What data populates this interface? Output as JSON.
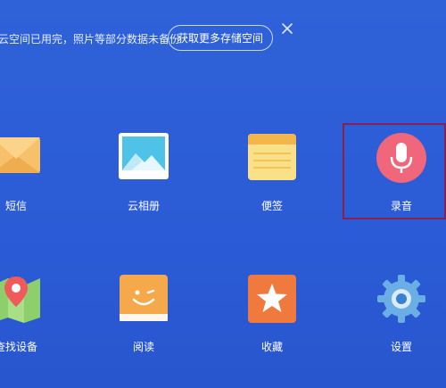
{
  "banner": {
    "text": "云空间已用完，照片等部分数据未备份",
    "button_label": "获取更多存储空间",
    "close_icon": "close-icon"
  },
  "apps": {
    "sms": {
      "label": "短信",
      "icon": "envelope-icon",
      "color": "#f7c06a"
    },
    "cloud_album": {
      "label": "云相册",
      "icon": "photo-icon",
      "color": "#4fc2e8"
    },
    "notes": {
      "label": "便签",
      "icon": "notepad-icon",
      "color": "#f8d46b"
    },
    "recorder": {
      "label": "录音",
      "icon": "microphone-icon",
      "color": "#f0667a"
    },
    "find_device": {
      "label": "查找设备",
      "icon": "map-pin-icon",
      "color": "#8dcf6b"
    },
    "reading": {
      "label": "阅读",
      "icon": "smiley-book-icon",
      "color": "#f5a94a"
    },
    "favorites": {
      "label": "收藏",
      "icon": "star-icon",
      "color": "#f07a3e"
    },
    "settings": {
      "label": "设置",
      "icon": "gear-icon",
      "color": "#6aaee5"
    }
  },
  "highlight_color": "#8a2050"
}
